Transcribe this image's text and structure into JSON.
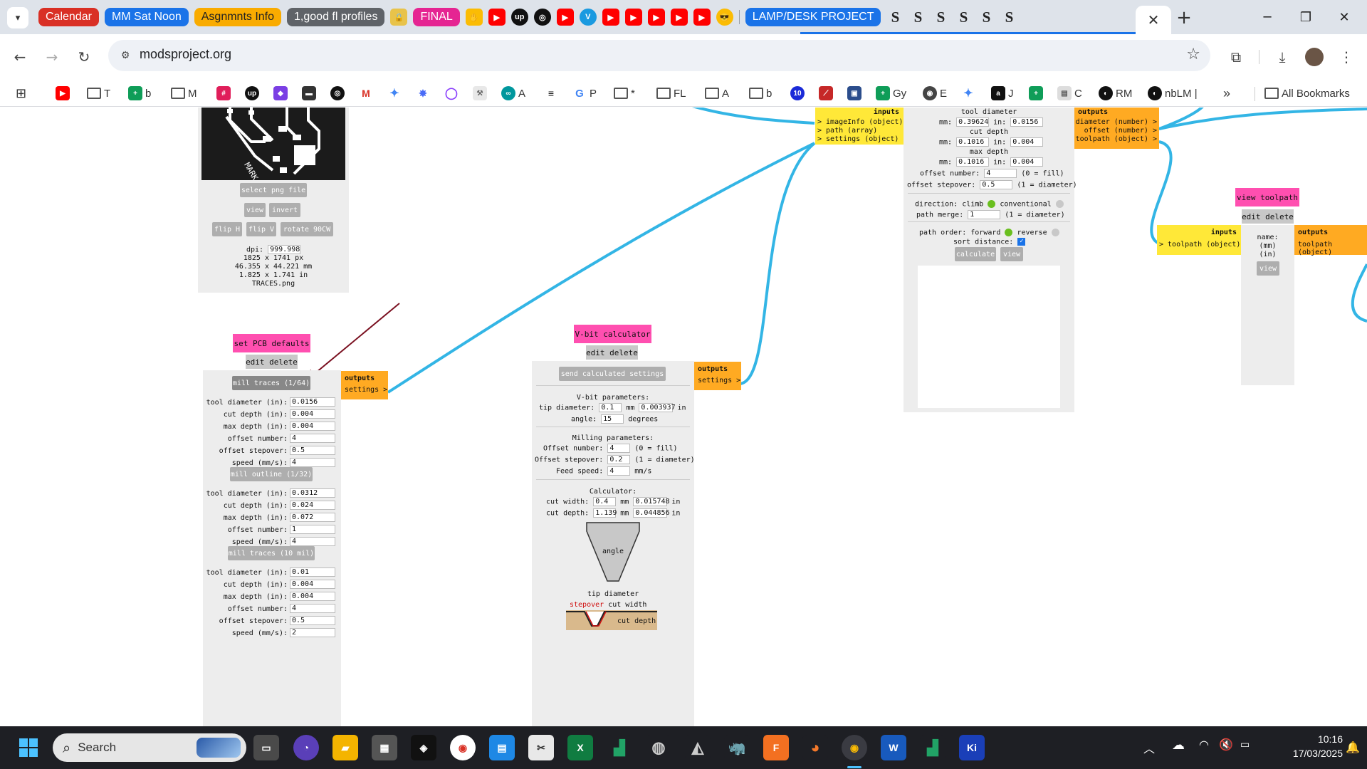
{
  "tab_groups": [
    {
      "label": "Calendar",
      "color": "#d93025"
    },
    {
      "label": "MM Sat Noon",
      "color": "#1a73e8"
    },
    {
      "label": "Asgnmnts Info",
      "color": "#f9ab00"
    },
    {
      "label": "1,good fl profiles",
      "color": "#5f6368"
    },
    {
      "label": "FINAL",
      "color": "#e52592"
    },
    {
      "label": "LAMP/DESK PROJECT",
      "color": "#1a73e8"
    }
  ],
  "browser": {
    "url": "modsproject.org"
  },
  "bookmarks": [
    "T",
    "b",
    "M",
    "A",
    "P",
    "*",
    "FL",
    "A",
    "b",
    "Gy",
    "E",
    "J",
    "C",
    "RM",
    "nbLM |",
    "All Bookmarks"
  ],
  "mods": {
    "pcb": {
      "title": "set PCB defaults",
      "edit": "edit delete",
      "mill_traces": "mill traces (1/64)",
      "traces_rows": [
        {
          "label": "tool diameter (in):",
          "value": "0.0156"
        },
        {
          "label": "cut depth (in):",
          "value": "0.004"
        },
        {
          "label": "max depth (in):",
          "value": "0.004"
        },
        {
          "label": "offset number:",
          "value": "4"
        },
        {
          "label": "offset stepover:",
          "value": "0.5"
        },
        {
          "label": "speed (mm/s):",
          "value": "4"
        }
      ],
      "mill_outline": "mill outline (1/32)",
      "outline_rows": [
        {
          "label": "tool diameter (in):",
          "value": "0.0312"
        },
        {
          "label": "cut depth (in):",
          "value": "0.024"
        },
        {
          "label": "max depth (in):",
          "value": "0.072"
        },
        {
          "label": "offset number:",
          "value": "1"
        },
        {
          "label": "speed (mm/s):",
          "value": "4"
        }
      ],
      "mill_10": "mill traces (10 mil)",
      "ten_rows": [
        {
          "label": "tool diameter (in):",
          "value": "0.01"
        },
        {
          "label": "cut depth (in):",
          "value": "0.004"
        },
        {
          "label": "max depth (in):",
          "value": "0.004"
        },
        {
          "label": "offset number:",
          "value": "4"
        },
        {
          "label": "offset stepover:",
          "value": "0.5"
        },
        {
          "label": "speed (mm/s):",
          "value": "2"
        }
      ],
      "outputs": "outputs",
      "out_settings": "settings >"
    },
    "png": {
      "select": "select png file",
      "view": "view",
      "invert": "invert",
      "flip_h": "flip H",
      "flip_v": "flip V",
      "rotate": "rotate 90CW",
      "dpi_label": "dpi:",
      "dpi": "999.998",
      "px": "1825 x 1741 px",
      "mm": "46.355 x 44.221 mm",
      "in": "1.825 x 1.741 in",
      "file": "TRACES.png",
      "logo_text": "MARK"
    },
    "vbit": {
      "title": "V-bit calculator",
      "edit": "edit delete",
      "send": "send calculated settings",
      "vbit_params": "V-bit parameters:",
      "tip_label": "tip diameter:",
      "tip_mm": "0.1",
      "mm": "mm",
      "tip_in": "0.003937",
      "in": "in",
      "angle_label": "angle:",
      "angle": "15",
      "degrees": "degrees",
      "milling": "Milling parameters:",
      "off_num_label": "Offset number:",
      "off_num": "4",
      "fill": "(0 = fill)",
      "off_step_label": "Offset stepover:",
      "off_step": "0.2",
      "diam": "(1 = diameter)",
      "feed_label": "Feed speed:",
      "feed": "4",
      "mms": "mm/s",
      "calc": "Calculator:",
      "cw_label": "cut width:",
      "cw_mm": "0.4",
      "cw_in": "0.015748",
      "cd_label": "cut depth:",
      "cd_mm": "1.139",
      "cd_in": "0.044856",
      "angle_word": "angle",
      "tip_word": "tip diameter",
      "stepover_word": "stepover",
      "cutwidth_word": "cut width",
      "cutdepth_word": "cut depth",
      "outputs": "outputs",
      "out_settings": "settings >"
    },
    "offset": {
      "inputs": "inputs",
      "in1": "> imageInfo (object)",
      "in2": "> path (array)",
      "in3": "> settings (object)",
      "tool_diam": "tool diameter",
      "mm": "mm:",
      "td_mm": "0.39624",
      "in": "in:",
      "td_in": "0.0156",
      "cut_depth": "cut depth",
      "cd_mm": "0.1016",
      "cd_in": "0.004",
      "max_depth": "max depth",
      "md_mm": "0.1016",
      "md_in": "0.004",
      "off_num_label": "offset number:",
      "off_num": "4",
      "fill": "(0 = fill)",
      "off_step_label": "offset stepover:",
      "off_step": "0.5",
      "diam": "(1 = diameter)",
      "direction": "direction: climb",
      "conventional": "conventional",
      "merge_label": "path merge:",
      "merge": "1",
      "merge_note": "(1 = diameter)",
      "order": "path order: forward",
      "reverse": "reverse",
      "sort": "sort distance:",
      "calculate": "calculate",
      "view": "view",
      "outputs": "outputs",
      "out1": "diameter (number) >",
      "out2": "offset (number) >",
      "out3": "toolpath (object) >"
    },
    "toolpath": {
      "title": "view toolpath",
      "edit": "edit delete",
      "inputs": "inputs",
      "in1": "> toolpath (object)",
      "name": "name:",
      "mm": "(mm)",
      "in": "(in)",
      "view": "view",
      "outputs": "outputs",
      "out1": "toolpath (object)"
    }
  },
  "taskbar": {
    "search": "Search",
    "time": "10:16",
    "date": "17/03/2025"
  }
}
